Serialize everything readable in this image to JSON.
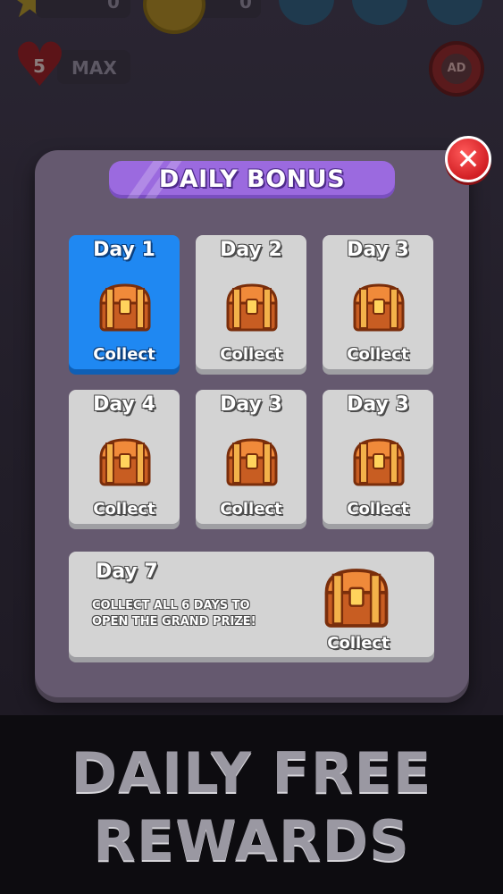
{
  "hud": {
    "stars_count": "0",
    "coins_count": "0",
    "lives_count": "5",
    "lives_status": "MAX",
    "ad_label": "AD"
  },
  "daily_bonus": {
    "title": "DAILY BONUS",
    "days": [
      {
        "label": "Day 1",
        "action": "Collect",
        "active": true
      },
      {
        "label": "Day 2",
        "action": "Collect",
        "active": false
      },
      {
        "label": "Day 3",
        "action": "Collect",
        "active": false
      },
      {
        "label": "Day 4",
        "action": "Collect",
        "active": false
      },
      {
        "label": "Day 3",
        "action": "Collect",
        "active": false
      },
      {
        "label": "Day 3",
        "action": "Collect",
        "active": false
      }
    ],
    "grand_prize": {
      "label": "Day 7",
      "description": "COLLECT ALL 6 DAYS TO OPEN THE GRAND PRIZE!",
      "action": "Collect"
    }
  },
  "banner": {
    "line1": "DAILY FREE",
    "line2": "REWARDS"
  },
  "colors": {
    "active_day": "#1f88f2",
    "title_bar": "#9b6adf",
    "modal": "#65596f",
    "close": "#d21f24"
  }
}
